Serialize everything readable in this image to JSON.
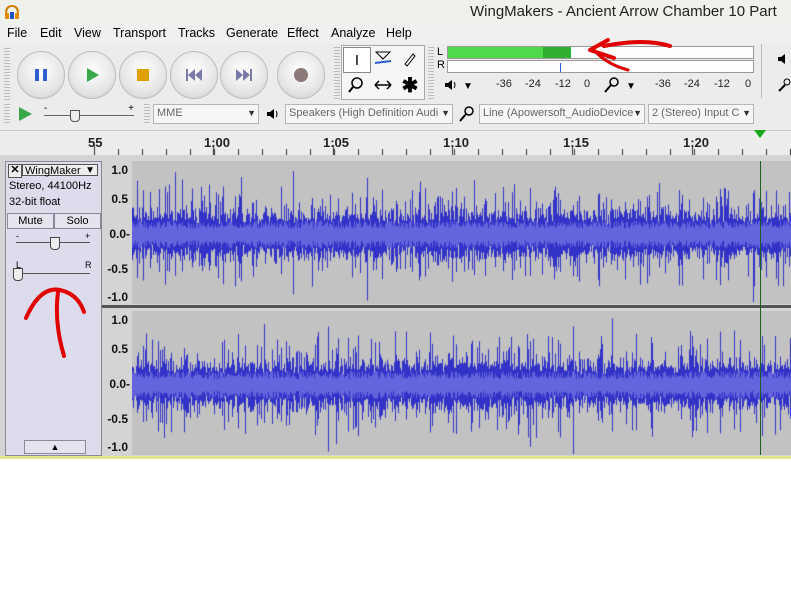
{
  "window": {
    "title": "WingMakers - Ancient Arrow Chamber 10 Part"
  },
  "menu": [
    "File",
    "Edit",
    "View",
    "Transport",
    "Tracks",
    "Generate",
    "Effect",
    "Analyze",
    "Help"
  ],
  "transport": {
    "buttons": [
      "pause",
      "play",
      "stop",
      "skip-to-start",
      "skip-to-end",
      "record"
    ]
  },
  "meters": {
    "left_label": "L",
    "right_label": "R",
    "playback_scale": [
      "-36",
      "-24",
      "-12",
      "0"
    ],
    "record_scale": [
      "-36",
      "-24",
      "-12",
      "0"
    ],
    "playback_level_fraction": 0.81
  },
  "device": {
    "host": "MME",
    "output": "Speakers (High Definition Audi",
    "input": "Line (Apowersoft_AudioDevice",
    "channels": "2 (Stereo) Input C"
  },
  "timeline": {
    "labels": [
      "55",
      "1:00",
      "1:05",
      "1:10",
      "1:15",
      "1:20"
    ]
  },
  "track": {
    "name": "WingMaker",
    "info_rate": "Stereo, 44100Hz",
    "info_format": "32-bit float",
    "mute_label": "Mute",
    "solo_label": "Solo",
    "gain_minus": "-",
    "gain_plus": "+",
    "pan_left": "L",
    "pan_right": "R",
    "vertical_ruler": [
      "1.0",
      "0.5",
      "0.0-",
      "-0.5",
      "-1.0"
    ]
  },
  "colors": {
    "waveform": "#3232c8",
    "waveform_light": "#6464dc",
    "meter_green": "#4cd94c",
    "annotation_red": "#e00000",
    "track_bg": "#c2c2c2"
  }
}
